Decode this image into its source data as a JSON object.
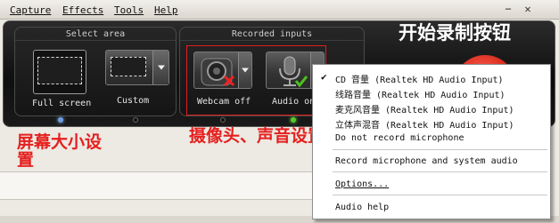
{
  "menubar": {
    "items": [
      {
        "label": "Capture"
      },
      {
        "label": "Effects"
      },
      {
        "label": "Tools"
      },
      {
        "label": "Help"
      }
    ],
    "minimize_glyph": "−",
    "close_glyph": "✕"
  },
  "select_area": {
    "title": "Select area",
    "full_screen_label": "Full screen",
    "custom_label": "Custom"
  },
  "recorded_inputs": {
    "title": "Recorded inputs",
    "webcam_label": "Webcam off",
    "audio_label": "Audio on"
  },
  "annotations": {
    "record_button_note": "开始录制按钮",
    "screen_size_note": "屏幕大小设置",
    "camera_audio_note": "摄像头、声音设置"
  },
  "audio_menu": {
    "items": [
      {
        "label": "CD 音量 (Realtek HD Audio Input)",
        "checked": true
      },
      {
        "label": "线路音量 (Realtek HD Audio Input)",
        "checked": false
      },
      {
        "label": "麦克风音量 (Realtek HD Audio Input)",
        "checked": false
      },
      {
        "label": "立体声混音 (Realtek HD Audio Input)",
        "checked": false
      },
      {
        "label": "Do not record microphone",
        "checked": false
      }
    ],
    "record_system_audio": "Record microphone and system audio",
    "options": "Options...",
    "audio_help": "Audio help"
  },
  "icons": [
    "webcam-icon",
    "microphone-icon",
    "checkmark-icon",
    "red-x-icon",
    "chevron-down-icon"
  ],
  "colors": {
    "annotation_red": "#e5201e",
    "panel_dark": "#1a1a1a",
    "record_red": "#d31d10",
    "check_green": "#4cc31f"
  }
}
